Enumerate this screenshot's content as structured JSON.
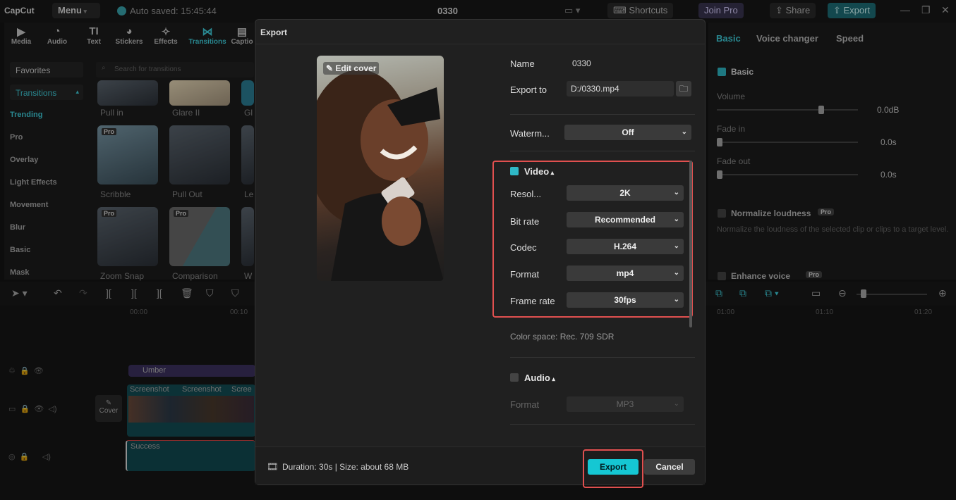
{
  "topbar": {
    "logo": "CapCut",
    "menu": "Menu",
    "autosave": "Auto saved: 15:45:44",
    "title": "0330",
    "shortcuts": "Shortcuts",
    "join_pro": "Join Pro",
    "share": "Share",
    "export": "Export"
  },
  "tools": [
    {
      "label": "Media",
      "icon": "media-icon"
    },
    {
      "label": "Audio",
      "icon": "audio-icon"
    },
    {
      "label": "Text",
      "icon": "text-icon"
    },
    {
      "label": "Stickers",
      "icon": "stickers-icon"
    },
    {
      "label": "Effects",
      "icon": "effects-icon"
    },
    {
      "label": "Transitions",
      "icon": "transitions-icon"
    },
    {
      "label": "Captio",
      "icon": "captions-icon"
    }
  ],
  "sidebar": {
    "favorites": "Favorites",
    "transitions": "Transitions",
    "items": [
      "Trending",
      "Pro",
      "Overlay",
      "Light Effects",
      "Movement",
      "Blur",
      "Basic",
      "Mask"
    ]
  },
  "search": {
    "placeholder": "Search for transitions"
  },
  "transitions_grid": {
    "row1": [
      "Pull in",
      "Glare II",
      "Gl"
    ],
    "row2": [
      "Scribble",
      "Pull Out",
      "Le"
    ],
    "row3": [
      "Zoom Snap",
      "Comparison",
      "W"
    ],
    "pro_badge": "Pro"
  },
  "timeline": {
    "ticks": [
      "00:00",
      "00:10"
    ],
    "right_ticks": [
      "01:00",
      "01:10",
      "01:20"
    ],
    "clip_title": "Umber",
    "video_clips": [
      "Screenshot",
      "Screenshot",
      "Scree"
    ],
    "audio_clip": "Success",
    "cover": "Cover"
  },
  "right_panel": {
    "tabs": [
      "Basic",
      "Voice changer",
      "Speed"
    ],
    "section": "Basic",
    "volume_label": "Volume",
    "volume_value": "0.0dB",
    "fade_in_label": "Fade in",
    "fade_in_value": "0.0s",
    "fade_out_label": "Fade out",
    "fade_out_value": "0.0s",
    "normalize": "Normalize loudness",
    "normalize_desc": "Normalize the loudness of the selected clip or clips to a target level.",
    "enhance": "Enhance voice",
    "pro_badge": "Pro"
  },
  "dialog": {
    "title": "Export",
    "edit_cover": "Edit cover",
    "name_label": "Name",
    "name_value": "0330",
    "export_to_label": "Export to",
    "export_to_value": "D:/0330.mp4",
    "watermark_label": "Waterm...",
    "watermark_value": "Off",
    "video_section": "Video",
    "resolution_label": "Resol...",
    "resolution_value": "2K",
    "bitrate_label": "Bit rate",
    "bitrate_value": "Recommended",
    "codec_label": "Codec",
    "codec_value": "H.264",
    "format_label": "Format",
    "format_value": "mp4",
    "framerate_label": "Frame rate",
    "framerate_value": "30fps",
    "color_space": "Color space: Rec. 709 SDR",
    "audio_section": "Audio",
    "audio_format_label": "Format",
    "audio_format_value": "MP3",
    "footer_info": "Duration: 30s | Size: about 68 MB",
    "export_button": "Export",
    "cancel_button": "Cancel"
  },
  "colors": {
    "accent": "#15c7d3",
    "highlight_border": "#e0504f",
    "dialog_bg": "#202020"
  }
}
